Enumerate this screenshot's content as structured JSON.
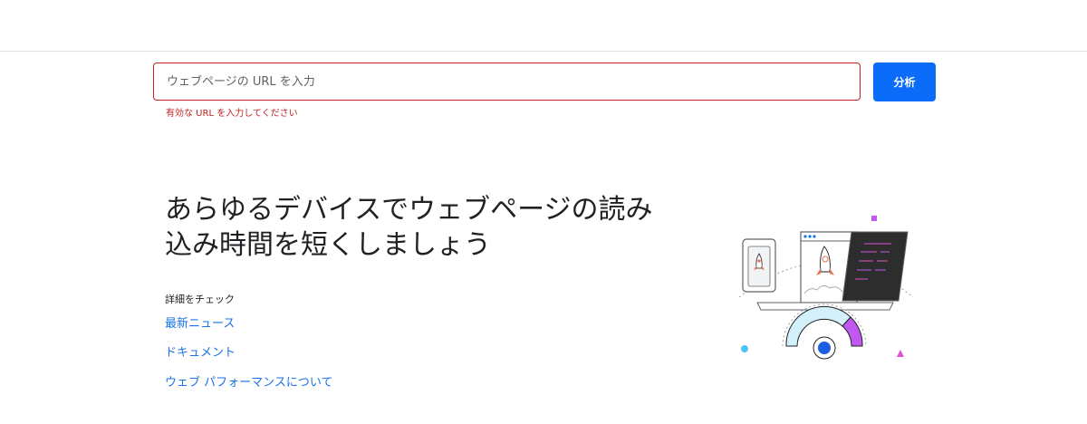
{
  "search": {
    "placeholder": "ウェブページの URL を入力",
    "error": "有効な URL を入力してください",
    "analyze_label": "分析"
  },
  "hero": {
    "title_line1": "あらゆるデバイスでウェブページの読み",
    "title_line2": "込み時間を短くしましょう",
    "check_label": "詳細をチェック",
    "links": [
      {
        "label": "最新ニュース"
      },
      {
        "label": "ドキュメント"
      },
      {
        "label": "ウェブ パフォーマンスについて"
      }
    ]
  },
  "colors": {
    "accent": "#0b6cf9",
    "error": "#c5221f",
    "link": "#1a73e8"
  },
  "illustration": {
    "icons": [
      "phone-rocket-icon",
      "browser-rocket-icon",
      "code-window-icon",
      "speed-gauge-icon"
    ]
  }
}
